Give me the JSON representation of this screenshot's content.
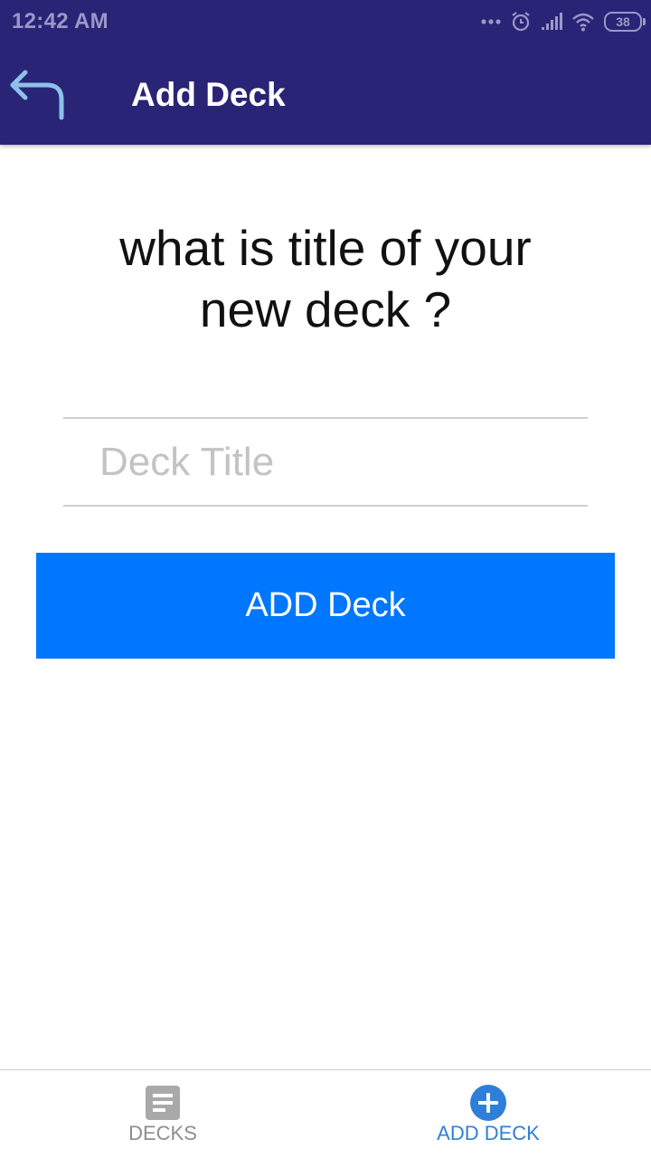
{
  "status_bar": {
    "time": "12:42 AM",
    "battery": "38",
    "icons": [
      "more-dots-icon",
      "alarm-icon",
      "signal-icon",
      "wifi-icon",
      "battery-icon"
    ]
  },
  "header": {
    "title": "Add Deck",
    "back_icon": "back-arrow-icon"
  },
  "main": {
    "question": "what is title of your new deck ?",
    "title_input": {
      "value": "",
      "placeholder": "Deck Title"
    },
    "add_button_label": "ADD Deck"
  },
  "tabbar": {
    "items": [
      {
        "label": "DECKS",
        "icon": "list-icon",
        "active": false
      },
      {
        "label": "ADD DECK",
        "icon": "add-circle-icon",
        "active": true
      }
    ]
  },
  "colors": {
    "header_bg": "#2a2477",
    "button_bg": "#0077fe",
    "active_tab": "#2f7fd8",
    "inactive_tab": "#8e8e8e",
    "back_icon": "#8ec1e8"
  }
}
